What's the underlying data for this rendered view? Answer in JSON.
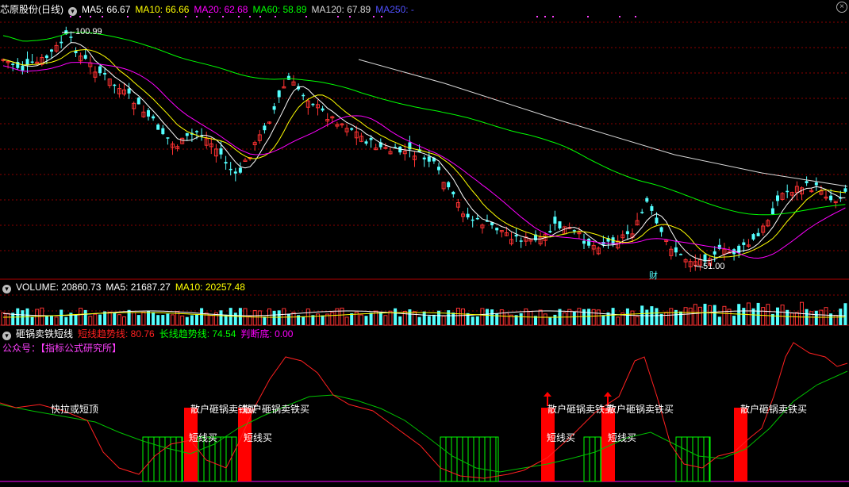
{
  "price_panel": {
    "stock_name": "芯原股份(日线)",
    "ma": [
      {
        "label": "MA5: 66.67",
        "color": "#ffffff"
      },
      {
        "label": "MA10: 66.66",
        "color": "#ffff00"
      },
      {
        "label": "MA20: 62.68",
        "color": "#ff00ff"
      },
      {
        "label": "MA60: 58.89",
        "color": "#00ff00"
      },
      {
        "label": "MA120: 67.89",
        "color": "#d8d8d8"
      },
      {
        "label": "MA250: -",
        "color": "#5050ff"
      }
    ],
    "high_label": "100.99",
    "low_label": "51.00",
    "finance_badge": "财"
  },
  "volume_panel": {
    "labels": [
      {
        "label": "VOLUME: 20860.73",
        "color": "#ffffff"
      },
      {
        "label": "MA5: 21687.27",
        "color": "#ffffff"
      },
      {
        "label": "MA10: 20257.48",
        "color": "#ffff00"
      }
    ]
  },
  "indicator_panel": {
    "title": "砸锅卖铁短线",
    "lines": [
      {
        "label": "短线趋势线: 80.76",
        "color": "#ff2020"
      },
      {
        "label": "长线趋势线: 74.54",
        "color": "#00ff00"
      },
      {
        "label": "判断底: 0.00",
        "color": "#ff00ff"
      }
    ],
    "public_account": "公众号：【指标公式研究所】",
    "signals": [
      "快拉或短顶",
      "散户砸锅卖铁买",
      "散户砸锅卖铁买",
      "散户砸锅卖铁买",
      "散户砸锅卖铁买",
      "散户砸锅卖铁买"
    ],
    "short_buy": [
      "短线买",
      "短线买",
      "短线买",
      "短线买"
    ]
  },
  "colors": {
    "up": "#ff3232",
    "down": "#54ffff",
    "grid": "#8b0000",
    "border": "#b00000",
    "ma5": "#ffffff",
    "ma10": "#ffff00",
    "ma20": "#ff00ff",
    "ma60": "#00ff00",
    "ma120": "#d8d8d8"
  }
}
